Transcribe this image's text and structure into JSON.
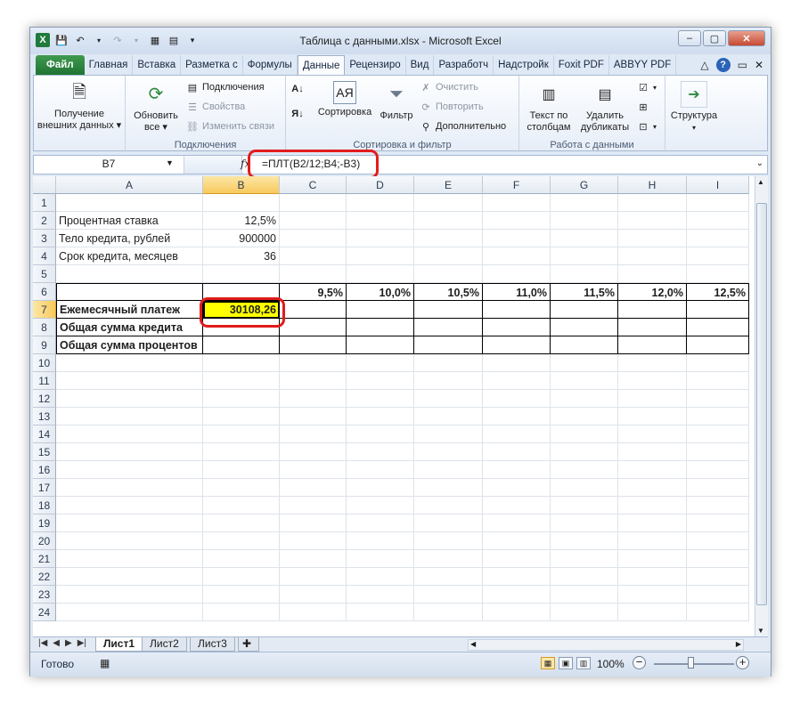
{
  "window": {
    "title": "Таблица с данными.xlsx - Microsoft Excel"
  },
  "tabs": [
    {
      "label": "Файл",
      "kind": "file"
    },
    {
      "label": "Главная"
    },
    {
      "label": "Вставка"
    },
    {
      "label": "Разметка с"
    },
    {
      "label": "Формулы"
    },
    {
      "label": "Данные",
      "active": true
    },
    {
      "label": "Рецензиро"
    },
    {
      "label": "Вид"
    },
    {
      "label": "Разработч"
    },
    {
      "label": "Надстройк"
    },
    {
      "label": "Foxit PDF"
    },
    {
      "label": "ABBYY PDF"
    }
  ],
  "ribbon": {
    "get_external": "Получение внешних данных",
    "get_external_l1": "Получение",
    "get_external_l2": "внешних данных ▾",
    "refresh_l1": "Обновить",
    "refresh_l2": "все ▾",
    "connections": "Подключения",
    "properties": "Свойства",
    "edit_links": "Изменить связи",
    "group_connections": "Подключения",
    "sort": "Сортировка",
    "filter": "Фильтр",
    "clear": "Очистить",
    "reapply": "Повторить",
    "advanced": "Дополнительно",
    "group_sort": "Сортировка и фильтр",
    "text_to_cols_l1": "Текст по",
    "text_to_cols_l2": "столбцам",
    "remove_dup_l1": "Удалить",
    "remove_dup_l2": "дубликаты",
    "group_data": "Работа с данными",
    "outline": "Структура"
  },
  "formula_bar": {
    "name_box": "B7",
    "fx": "fx",
    "formula": "=ПЛТ(B2/12;B4;-B3)"
  },
  "columns": [
    "A",
    "B",
    "C",
    "D",
    "E",
    "F",
    "G",
    "H",
    "I"
  ],
  "rows": [
    "1",
    "2",
    "3",
    "4",
    "5",
    "6",
    "7",
    "8",
    "9",
    "10",
    "11",
    "12",
    "13",
    "14",
    "15",
    "16",
    "17",
    "18",
    "19",
    "20",
    "21",
    "22",
    "23",
    "24"
  ],
  "cells": {
    "A2": "Процентная ставка",
    "B2": "12,5%",
    "A3": "Тело кредита, рублей",
    "B3": "900000",
    "A4": "Срок кредита, месяцев",
    "B4": "36",
    "C6": "9,5%",
    "D6": "10,0%",
    "E6": "10,5%",
    "F6": "11,0%",
    "G6": "11,5%",
    "H6": "12,0%",
    "I6": "12,5%",
    "A7": "Ежемесячный платеж",
    "B7": "30108,26",
    "A8": "Общая сумма кредита",
    "A9": "Общая сумма процентов"
  },
  "sheets": [
    "Лист1",
    "Лист2",
    "Лист3"
  ],
  "active_sheet": "Лист1",
  "status": {
    "ready": "Готово",
    "zoom": "100%"
  },
  "colors": {
    "selected_cell_fill": "#ffff00",
    "highlight_frame": "#e21c1c"
  }
}
